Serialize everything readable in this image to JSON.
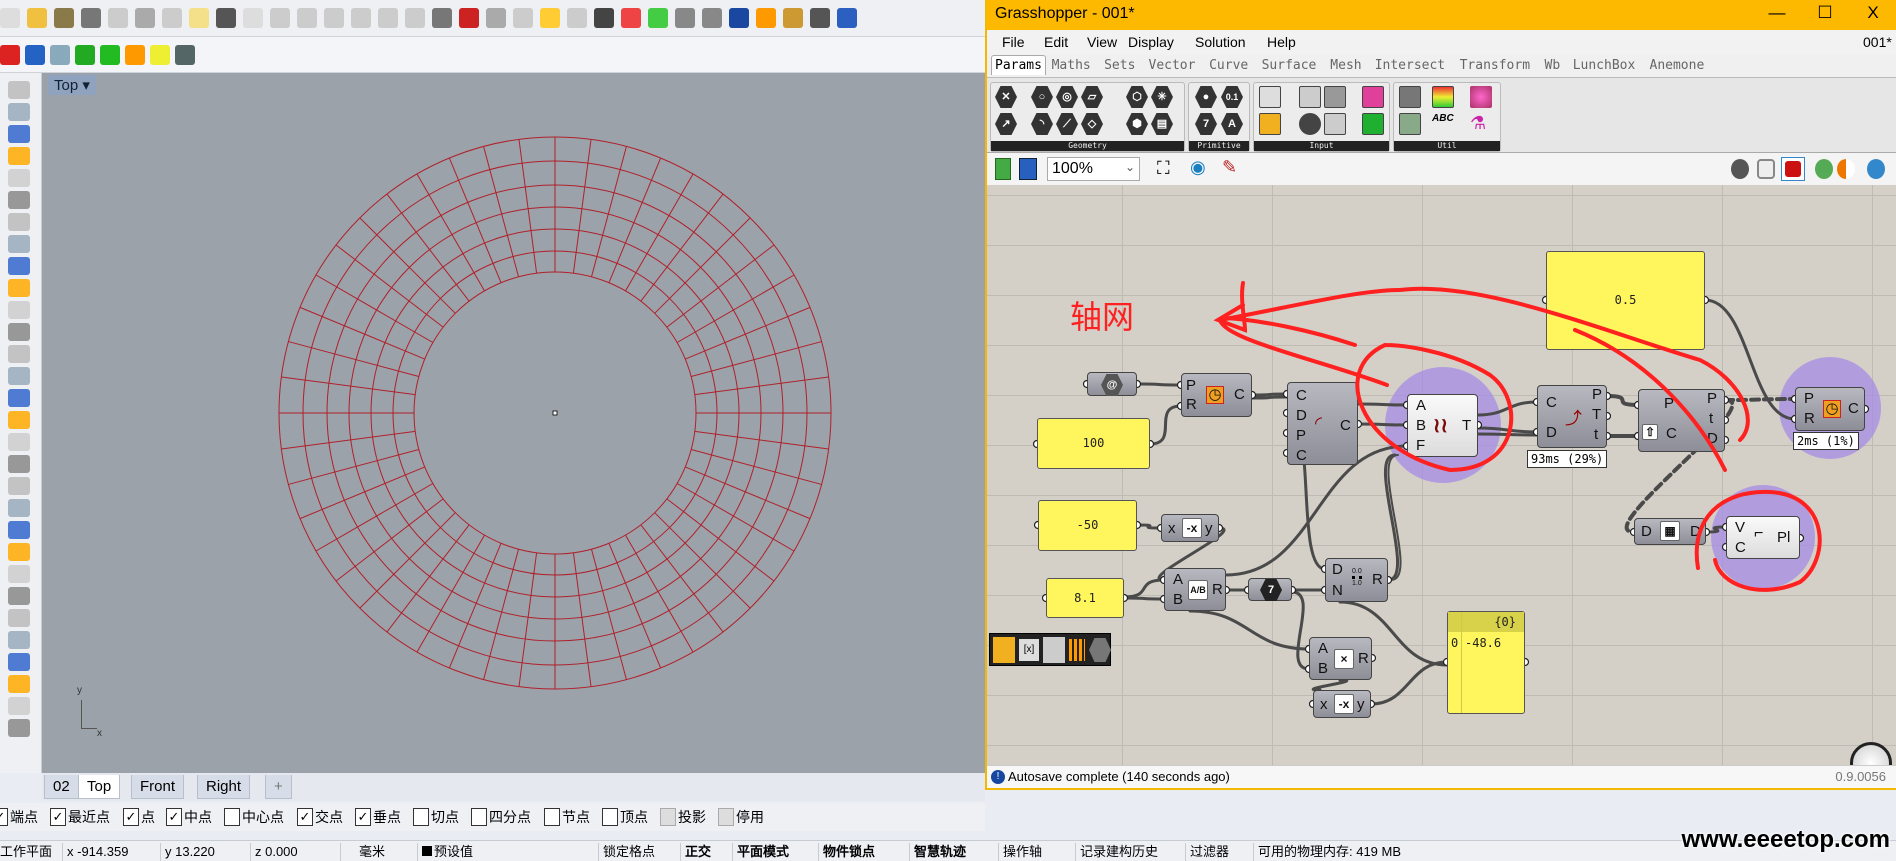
{
  "rhino": {
    "viewport": {
      "name": "Top",
      "tabs": [
        "02",
        "Top",
        "Front",
        "Right",
        "+"
      ],
      "active_tab": "Top",
      "axis_x": "x",
      "axis_y": "y",
      "curve_color": "#b0202a",
      "background": "#9ba2aa"
    },
    "osnap": [
      {
        "label": "端点",
        "checked": true
      },
      {
        "label": "最近点",
        "checked": true
      },
      {
        "label": "点",
        "checked": true
      },
      {
        "label": "中点",
        "checked": true
      },
      {
        "label": "中心点",
        "checked": false
      },
      {
        "label": "交点",
        "checked": true
      },
      {
        "label": "垂点",
        "checked": true
      },
      {
        "label": "切点",
        "checked": false
      },
      {
        "label": "四分点",
        "checked": false
      },
      {
        "label": "节点",
        "checked": false
      },
      {
        "label": "顶点",
        "checked": false
      },
      {
        "label": "投影",
        "checked": false,
        "disabled": true
      },
      {
        "label": "停用",
        "checked": false,
        "disabled": true
      }
    ],
    "status": {
      "cplane": "工作平面",
      "x": "x -914.359",
      "y": "y 13.220",
      "z": "z 0.000",
      "units": "毫米",
      "layer": "预设值",
      "grid_snap": "锁定格点",
      "ortho": "正交",
      "planar": "平面模式",
      "osnap": "物件锁点",
      "smarttrack": "智慧轨迹",
      "gumball": "操作轴",
      "history": "记录建构历史",
      "filter": "过滤器",
      "memory": "可用的物理内存: 419 MB"
    }
  },
  "watermark": "www.eeeetop.com",
  "grasshopper": {
    "title": "Grasshopper - 001*",
    "doc_name": "001*",
    "window_controls": [
      "—",
      "☐",
      "X"
    ],
    "menu": [
      "File",
      "Edit",
      "View",
      "Display",
      "Solution",
      "Help"
    ],
    "tabs": [
      "Params",
      "Maths",
      "Sets",
      "Vector",
      "Curve",
      "Surface",
      "Mesh",
      "Intersect",
      "Transform",
      "Wb",
      "LunchBox",
      "Anemone"
    ],
    "active_tab": "Params",
    "ribbon_groups": [
      "Geometry",
      "Primitive",
      "Input",
      "Util"
    ],
    "primitive_icons": [
      "7",
      "A",
      "0.1"
    ],
    "zoom": "100%",
    "annotation": "轴网",
    "nodes": {
      "circle1": {
        "inputs": [
          "P",
          "R"
        ],
        "outputs": [
          "C"
        ]
      },
      "divide": {
        "inputs": [
          "C",
          "D",
          "P",
          "C"
        ],
        "outputs": [
          "C"
        ]
      },
      "tween": {
        "inputs": [
          "A",
          "B",
          "F"
        ],
        "outputs": [
          "T"
        ]
      },
      "evaluate": {
        "inputs": [
          "C",
          "D"
        ],
        "outputs": [
          "P",
          "T",
          "t"
        ],
        "timing": "93ms (29%)"
      },
      "frame": {
        "inputs": [
          "P",
          "C"
        ],
        "outputs": [
          "P",
          "t",
          "D"
        ]
      },
      "circle2": {
        "inputs": [
          "P",
          "R"
        ],
        "outputs": [
          "C"
        ],
        "timing": "2ms (1%)"
      },
      "flip": {
        "inputs": [
          "D"
        ],
        "outputs": [
          "D"
        ]
      },
      "polyline": {
        "inputs": [
          "V",
          "C"
        ],
        "outputs": [
          "Pl"
        ]
      },
      "negative1": {
        "inputs": [
          "x"
        ],
        "outputs": [
          "y"
        ],
        "icon": "-x"
      },
      "division": {
        "inputs": [
          "A",
          "B"
        ],
        "outputs": [
          "R"
        ],
        "icon": "A/B"
      },
      "integer": {
        "label": "7"
      },
      "range": {
        "inputs": [
          "D",
          "N"
        ],
        "outputs": [
          "R"
        ],
        "icon_top": "0.0",
        "icon_bottom": "1.0"
      },
      "multiply": {
        "inputs": [
          "A",
          "B"
        ],
        "outputs": [
          "R"
        ],
        "icon": "×"
      },
      "negative2": {
        "inputs": [
          "x"
        ],
        "outputs": [
          "y"
        ],
        "icon": "-x"
      }
    },
    "panels": {
      "p05": "0.5",
      "p100": "100",
      "pm50": "-50",
      "p81": "8.1"
    },
    "data_panel": {
      "path": "{0}",
      "index": "0",
      "value": "-48.6"
    },
    "status": "Autosave complete (140 seconds ago)",
    "version": "0.9.0056",
    "colors": {
      "title_bar": "#fdb900",
      "panel": "#fff55c",
      "selection_halo": "#a58ce6",
      "annotation": "#ff2020"
    }
  }
}
